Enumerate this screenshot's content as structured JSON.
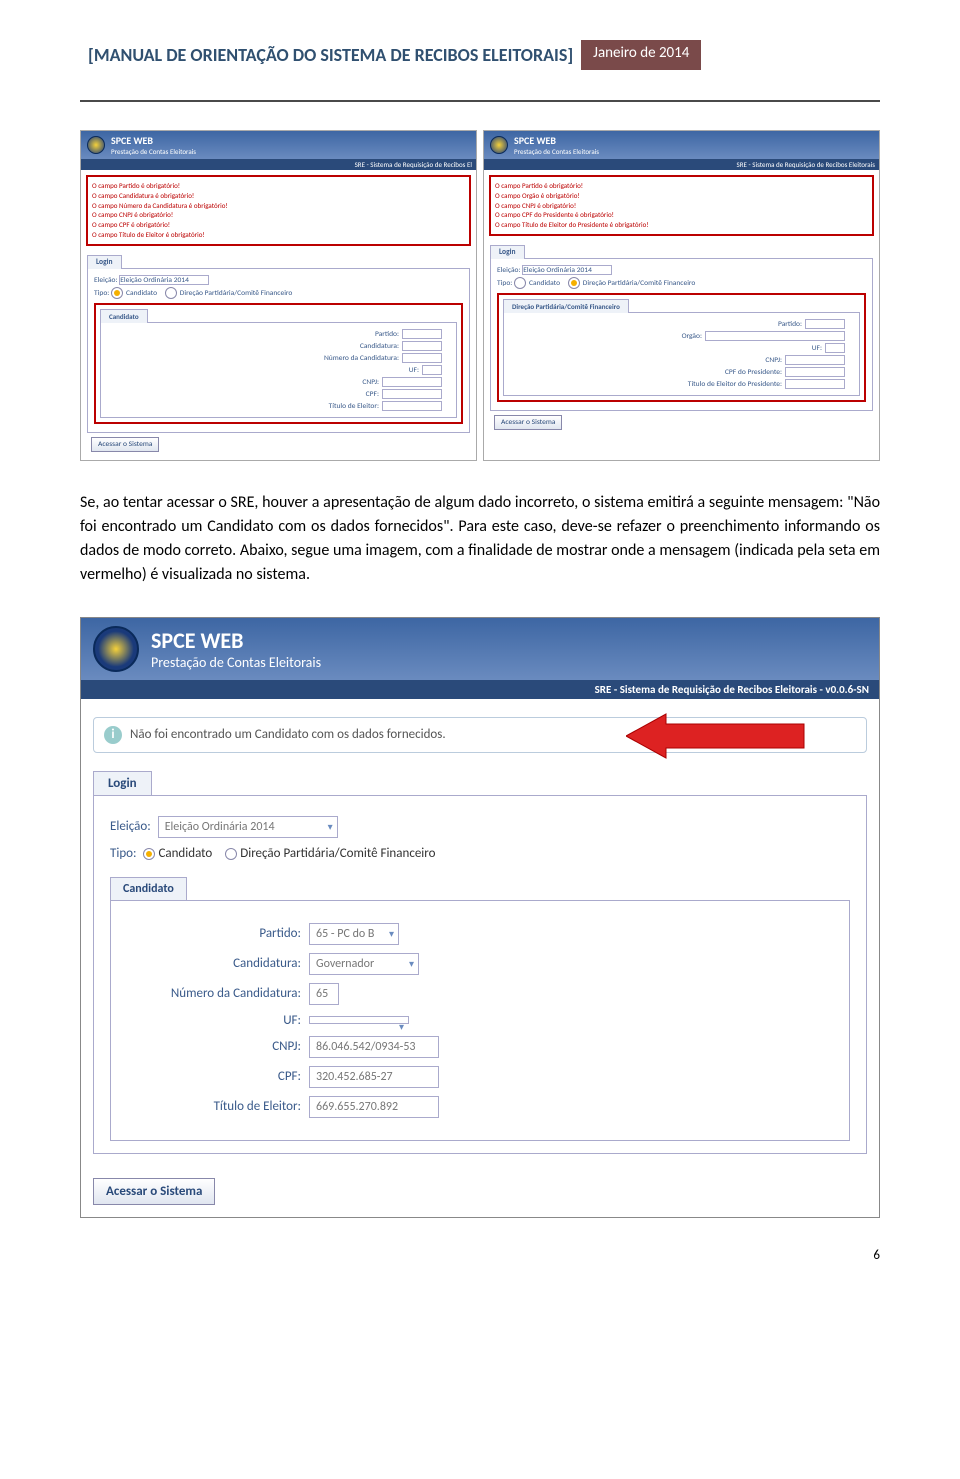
{
  "header": {
    "title": "[MANUAL DE ORIENTAÇÃO DO SISTEMA DE RECIBOS ELEITORAIS]",
    "date": "Janeiro de 2014"
  },
  "small_left": {
    "app_title": "SPCE WEB",
    "app_sub": "Prestação de Contas Eleitorais",
    "sre_strip": "SRE - Sistema de Requisição de Recibos El",
    "errors": [
      "O campo Partido é obrigatório!",
      "O campo Candidatura é obrigatório!",
      "O campo Número da Candidatura é obrigatório!",
      "O campo CNPJ é obrigatório!",
      "O campo CPF é obrigatório!",
      "O campo Título de Eleitor é obrigatório!"
    ],
    "login_tab": "Login",
    "eleicao_label": "Eleição:",
    "eleicao_value": "Eleição Ordinária 2014",
    "tipo_label": "Tipo:",
    "tipo_opt1": "Candidato",
    "tipo_opt2": "Direção Partidária/Comitê Financeiro",
    "cand_tab": "Candidato",
    "fields": {
      "partido": "Partido:",
      "candidatura": "Candidatura:",
      "numero": "Número da Candidatura:",
      "uf": "UF:",
      "cnpj": "CNPJ:",
      "cpf": "CPF:",
      "titulo": "Título de Eleitor:"
    },
    "button": "Acessar o Sistema"
  },
  "small_right": {
    "app_title": "SPCE WEB",
    "app_sub": "Prestação de Contas Eleitorais",
    "sre_strip": "SRE - Sistema de Requisição de Recibos Eleitorais",
    "errors": [
      "O campo Partido é obrigatório!",
      "O campo Orgão é obrigatório!",
      "O campo CNPJ é obrigatório!",
      "O campo CPF do Presidente é obrigatório!",
      "O campo Título de Eleitor do Presidente é obrigatório!"
    ],
    "login_tab": "Login",
    "eleicao_label": "Eleição:",
    "eleicao_value": "Eleição Ordinária 2014",
    "tipo_label": "Tipo:",
    "tipo_opt1": "Candidato",
    "tipo_opt2": "Direção Partidária/Comitê Financeiro",
    "dir_tab": "Direção Partidária/Comitê Financeiro",
    "fields": {
      "partido": "Partido:",
      "orgao": "Orgão:",
      "uf": "UF:",
      "cnpj": "CNPJ:",
      "cpf": "CPF do Presidente:",
      "titulo": "Título de Eleitor do Presidente:"
    },
    "button": "Acessar o Sistema"
  },
  "paragraph": "Se, ao tentar acessar o SRE, houver a apresentação de algum dado incorreto, o sistema emitirá a seguinte mensagem: \"Não foi encontrado um Candidato com os dados fornecidos\". Para este caso, deve-se refazer o preenchimento informando os dados de modo correto. Abaixo, segue uma imagem, com a finalidade de mostrar onde a mensagem (indicada pela seta em vermelho) é visualizada no sistema.",
  "big": {
    "app_title": "SPCE WEB",
    "app_sub": "Prestação de Contas Eleitorais",
    "sre_strip": "SRE - Sistema de Requisição de Recibos Eleitorais - v0.0.6-SN",
    "info_msg": "Não foi encontrado um Candidato com os dados fornecidos.",
    "login_tab": "Login",
    "eleicao_label": "Eleição:",
    "eleicao_value": "Eleição Ordinária 2014",
    "tipo_label": "Tipo:",
    "tipo_opt1": "Candidato",
    "tipo_opt2": "Direção Partidária/Comitê Financeiro",
    "cand_tab": "Candidato",
    "fields": {
      "partido_label": "Partido:",
      "partido_value": "65 - PC do B",
      "candidatura_label": "Candidatura:",
      "candidatura_value": "Governador",
      "numero_label": "Número da Candidatura:",
      "numero_value": "65",
      "uf_label": "UF:",
      "uf_value": "",
      "cnpj_label": "CNPJ:",
      "cnpj_value": "86.046.542/0934-53",
      "cpf_label": "CPF:",
      "cpf_value": "320.452.685-27",
      "titulo_label": "Título de Eleitor:",
      "titulo_value": "669.655.270.892"
    },
    "button": "Acessar o Sistema"
  },
  "page_number": "6"
}
